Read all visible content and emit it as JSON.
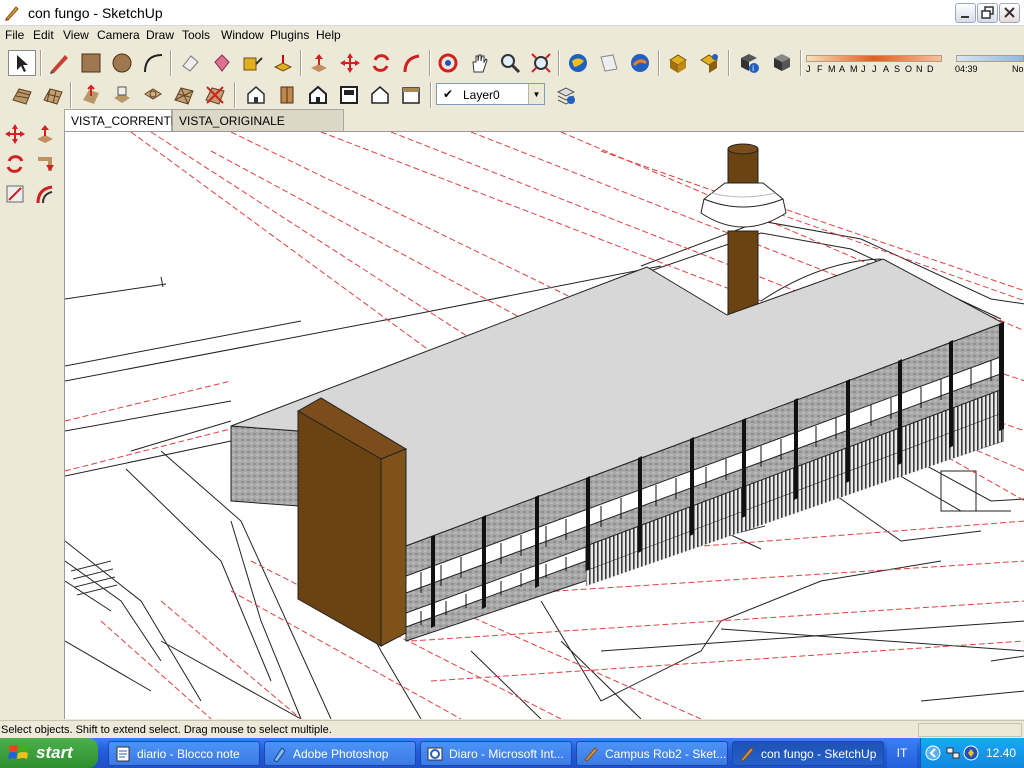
{
  "window": {
    "title": "con fungo - SketchUp"
  },
  "menu": [
    "File",
    "Edit",
    "View",
    "Camera",
    "Draw",
    "Tools",
    "Window",
    "Plugins",
    "Help"
  ],
  "toolbar": {
    "row1_icons": [
      "select-icon",
      "pencil-icon",
      "rectangle-icon",
      "circle-icon",
      "arc-icon",
      "eraser-icon",
      "paint-bucket-icon",
      "tape-measure-icon",
      "push-pull-icon",
      "move-icon",
      "rotate-icon",
      "follow-me-icon",
      "orbit-icon",
      "pan-icon",
      "zoom-icon",
      "zoom-extents-icon",
      "google-earth-icon",
      "get-models-icon",
      "share-model-icon",
      "components-icon",
      "materials-icon",
      "add-location-icon",
      "toggle-terrain-icon"
    ],
    "row2_icons": [
      "sandbox-from-contours-icon",
      "sandbox-from-scratch-icon",
      "smoove-icon",
      "stamp-icon",
      "drape-icon",
      "add-detail-icon",
      "flip-edge-icon",
      "iso-view-icon",
      "top-view-icon",
      "front-view-icon",
      "right-view-icon",
      "back-view-icon",
      "left-view-icon",
      "layer-manager-icon"
    ],
    "layer": {
      "name": "Layer0",
      "checked": "✔"
    }
  },
  "shadows": {
    "months": [
      "J",
      "F",
      "M",
      "A",
      "M",
      "J",
      "J",
      "A",
      "S",
      "O",
      "N",
      "D"
    ],
    "time": "04:39",
    "noon": "No"
  },
  "scene_tabs": [
    "VISTA_CORRENTE",
    "VISTA_ORIGINALE"
  ],
  "left_toolbar": [
    "move-icon",
    "push-pull-icon",
    "rotate-icon",
    "follow-me-icon",
    "scale-icon",
    "offset-icon"
  ],
  "status": {
    "text": "Select objects. Shift to extend select. Drag mouse to select multiple."
  },
  "taskbar": {
    "start": "start",
    "tasks": [
      {
        "label": "diario - Blocco note",
        "icon": "notepad-icon"
      },
      {
        "label": "Adobe Photoshop",
        "icon": "photoshop-icon"
      },
      {
        "label": "Diaro - Microsoft Int...",
        "icon": "internet-explorer-icon"
      },
      {
        "label": "Campus Rob2 - Sket...",
        "icon": "sketchup-icon"
      },
      {
        "label": "con fungo - SketchUp",
        "icon": "sketchup-icon"
      }
    ],
    "lang": "IT",
    "clock": "12.40"
  },
  "colors": {
    "roof": "#d7d7d7",
    "facade": "#9b9b9b",
    "tower": "#6b4212",
    "guideline": "#e04040"
  }
}
